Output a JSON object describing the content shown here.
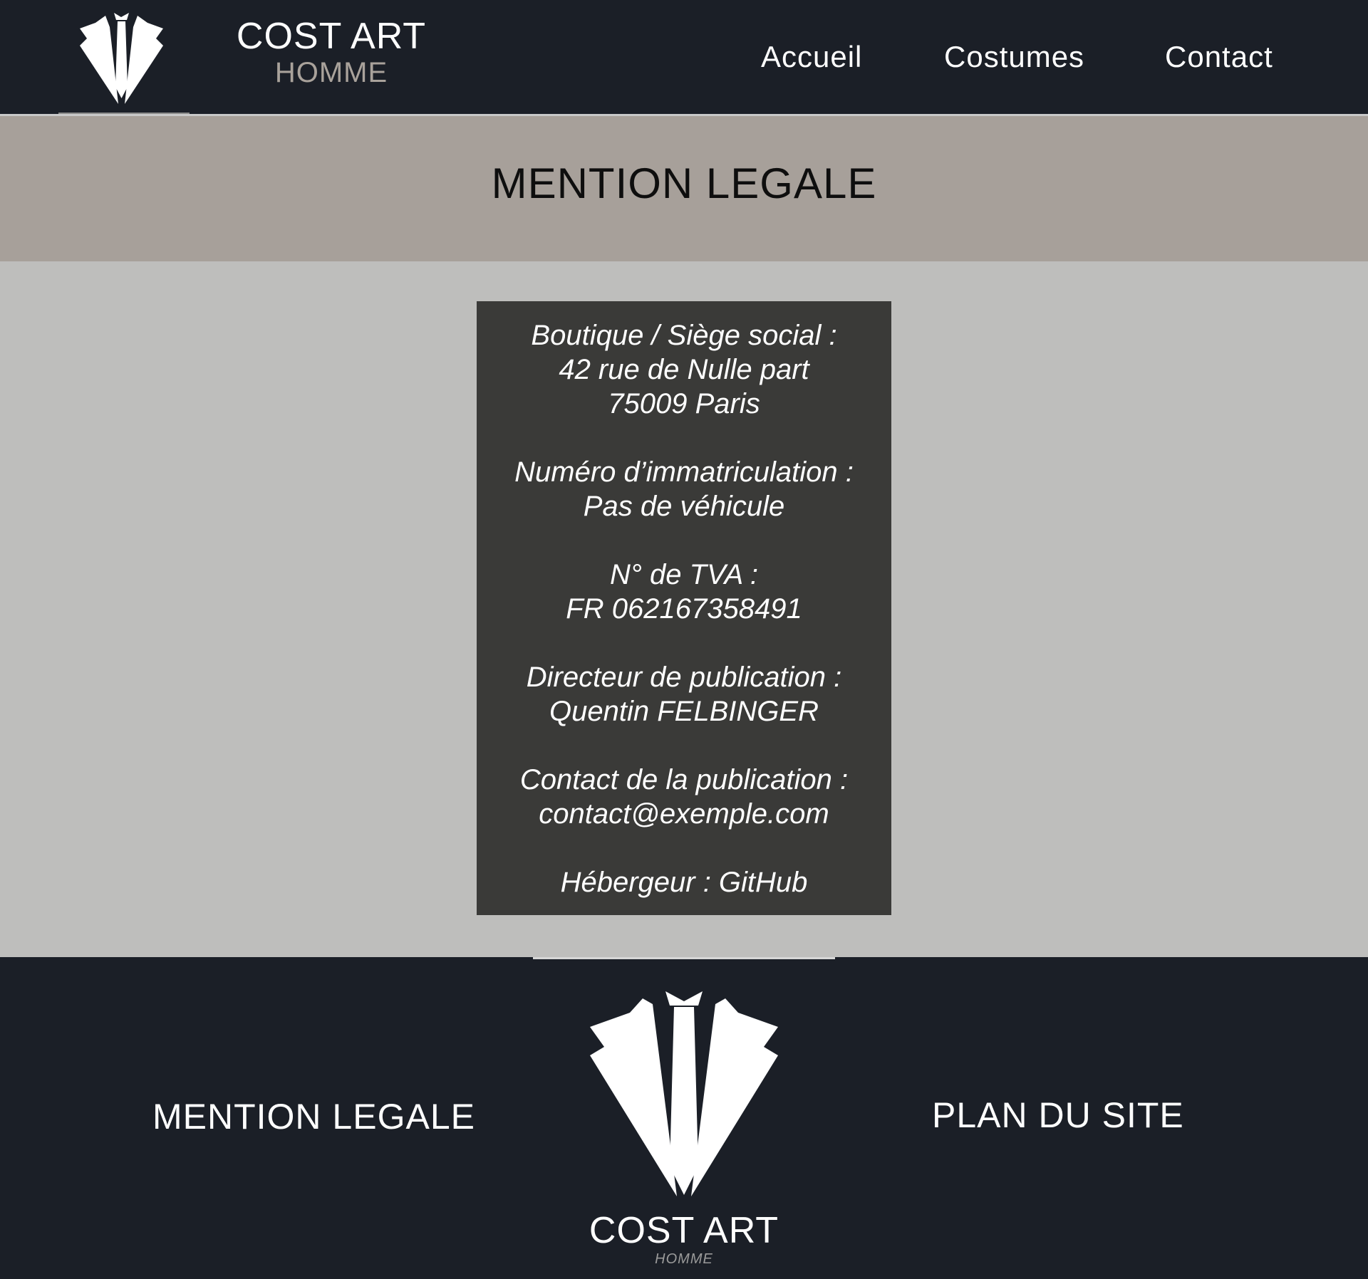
{
  "header": {
    "brand_name": "COST ART",
    "brand_sub": "HOMME",
    "nav": [
      {
        "label": "Accueil"
      },
      {
        "label": "Costumes"
      },
      {
        "label": "Contact"
      }
    ]
  },
  "page_title": "MENTION LEGALE",
  "legal": [
    {
      "lines": [
        "Boutique / Siège social :",
        "42 rue de Nulle part",
        "75009 Paris"
      ]
    },
    {
      "lines": [
        "Numéro d’immatriculation :",
        "Pas de véhicule"
      ]
    },
    {
      "lines": [
        "N° de TVA :",
        "FR 062167358491"
      ]
    },
    {
      "lines": [
        "Directeur de publication :",
        "Quentin FELBINGER"
      ]
    },
    {
      "lines": [
        "Contact de la publication :",
        "contact@exemple.com"
      ]
    },
    {
      "lines": [
        "Hébergeur : GitHub"
      ]
    }
  ],
  "footer": {
    "left_link": "MENTION LEGALE",
    "right_link": "PLAN DU SITE",
    "brand_name": "COST ART",
    "brand_sub": "HOMME"
  },
  "colors": {
    "header_bg": "#1b1f27",
    "title_band_bg": "#a7a09a",
    "main_bg": "#bebebc",
    "card_bg": "#3a3a38",
    "accent_muted": "#a9a29b"
  },
  "icons": {
    "header_logo": "suit-tie-logo-icon",
    "footer_logo": "suit-tie-logo-icon"
  }
}
